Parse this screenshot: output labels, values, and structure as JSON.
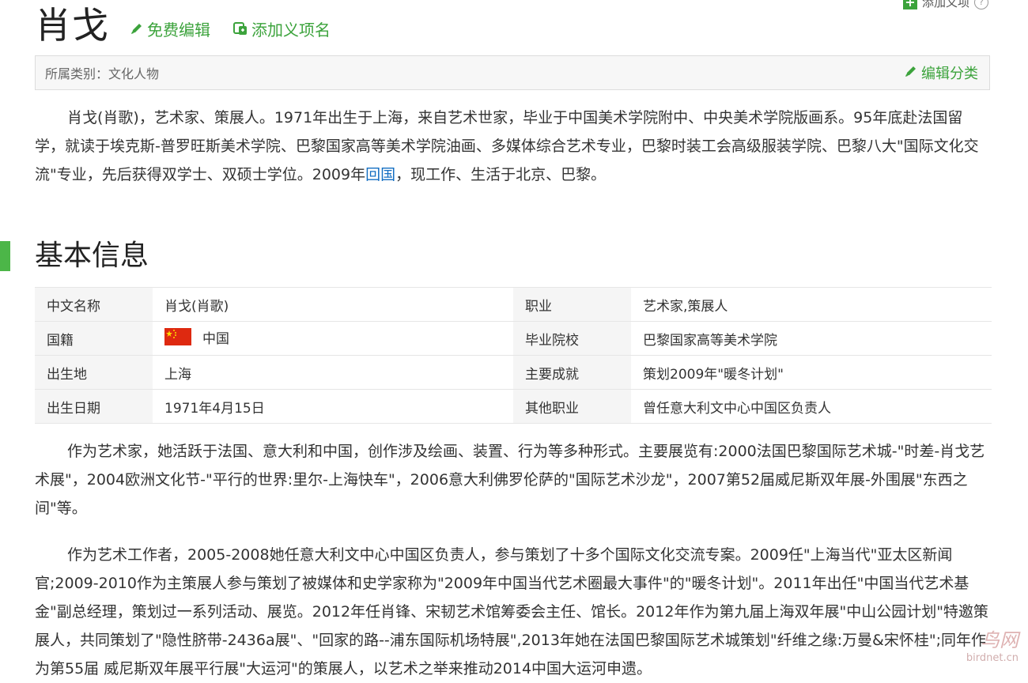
{
  "top_action": {
    "add_item_label": "添加义项"
  },
  "header": {
    "title": "肖戈",
    "free_edit_label": "免费编辑",
    "add_name_label": "添加义项名"
  },
  "category": {
    "text": "所属类别：文化人物",
    "edit_label": "编辑分类"
  },
  "intro": {
    "before_link": "肖戈(肖歌)，艺术家、策展人。1971年出生于上海，来自艺术世家，毕业于中国美术学院附中、中央美术学院版画系。95年底赴法国留学，就读于埃克斯-普罗旺斯美术学院、巴黎国家高等美术学院油画、多媒体综合艺术专业，巴黎时装工会高级服装学院、巴黎八大\"国际文化交流\"专业，先后获得双学士、双硕士学位。2009年",
    "link": "回国",
    "after_link": "，现工作、生活于北京、巴黎。"
  },
  "basic_info": {
    "title": "基本信息",
    "rows": [
      {
        "k1": "中文名称",
        "v1": "肖戈(肖歌)",
        "k2": "职业",
        "v2": "艺术家,策展人"
      },
      {
        "k1": "国籍",
        "v1": "中国",
        "k2": "毕业院校",
        "v2": "巴黎国家高等美术学院"
      },
      {
        "k1": "出生地",
        "v1": "上海",
        "k2": "主要成就",
        "v2": "策划2009年\"暖冬计划\""
      },
      {
        "k1": "出生日期",
        "v1": "1971年4月15日",
        "k2": "其他职业",
        "v2": "曾任意大利文中心中国区负责人"
      }
    ]
  },
  "paragraphs": {
    "p1": "作为艺术家，她活跃于法国、意大利和中国，创作涉及绘画、装置、行为等多种形式。主要展览有:2000法国巴黎国际艺术城-\"时差-肖戈艺术展\"，2004欧洲文化节-\"平行的世界:里尔-上海快车\"，2006意大利佛罗伦萨的\"国际艺术沙龙\"，2007第52届威尼斯双年展-外围展\"东西之间\"等。",
    "p2": "作为艺术工作者，2005-2008她任意大利文中心中国区负责人，参与策划了十多个国际文化交流专案。2009任\"上海当代\"亚太区新闻官;2009-2010作为主策展人参与策划了被媒体和史学家称为\"2009年中国当代艺术圈最大事件\"的\"暖冬计划\"。2011年出任\"中国当代艺术基金\"副总经理，策划过一系列活动、展览。2012年任肖锋、宋韧艺术馆筹委会主任、馆长。2012年作为第九届上海双年展\"中山公园计划\"特邀策展人，共同策划了\"隐性脐带-2436a展\"、\"回家的路--浦东国际机场特展\",2013年她在法国巴黎国际艺术城策划\"纤维之缘:万曼&宋怀桂\";同年作为第55届 威尼斯双年展平行展\"大运河\"的策展人，以艺术之举来推动2014中国大运河申遗。"
  },
  "watermark": {
    "main": "鸟网",
    "sub": "birdnet.cn"
  },
  "colors": {
    "accent_green": "#3ca33c",
    "link_blue": "#136ec2",
    "section_bar": "#4cb648"
  }
}
